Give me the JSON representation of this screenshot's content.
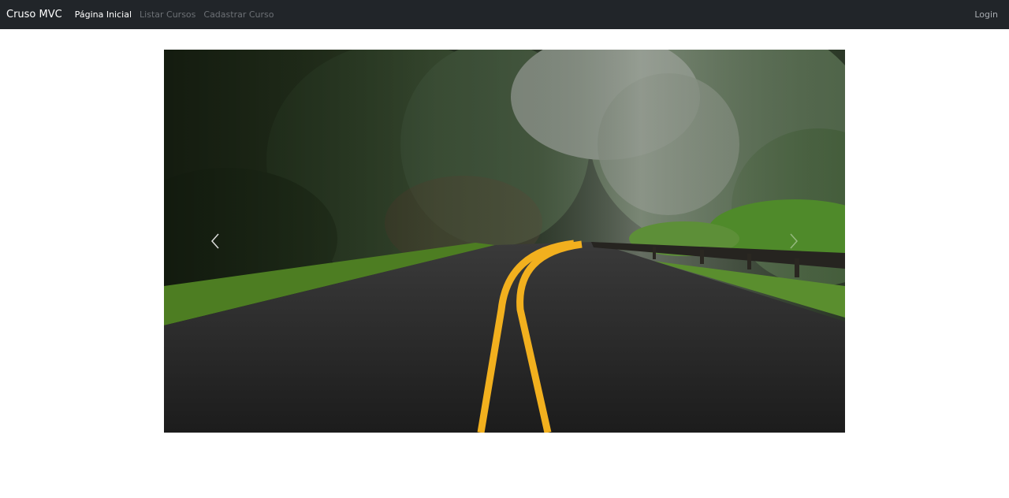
{
  "navbar": {
    "brand": "Cruso MVC",
    "links": [
      {
        "label": "Página Inicial",
        "state": "active"
      },
      {
        "label": "Listar Cursos",
        "state": "muted"
      },
      {
        "label": "Cadastrar Curso",
        "state": "muted"
      }
    ],
    "login": "Login"
  },
  "carousel": {
    "image": "forest-road-photo",
    "prev_icon": "chevron-left-icon",
    "next_icon": "chevron-right-icon"
  },
  "colors": {
    "navbar_bg": "#212529",
    "road_line": "#f2b01e"
  }
}
